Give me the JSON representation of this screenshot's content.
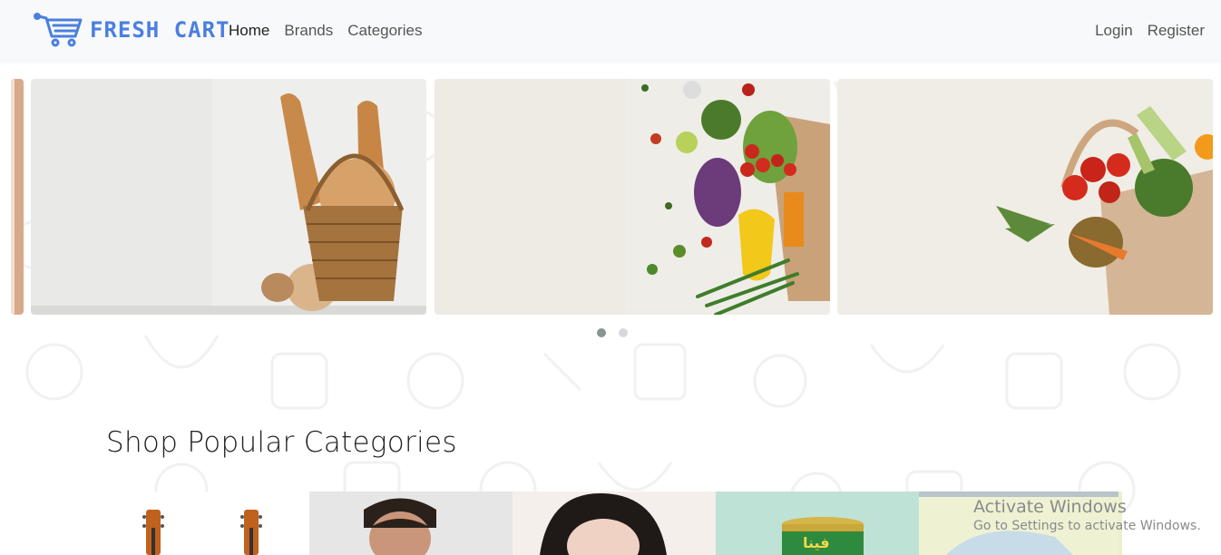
{
  "brand": {
    "name": "FRESH CART",
    "logo_icon": "shopping-cart-icon",
    "color": "#4a7fe0"
  },
  "nav": {
    "links": [
      {
        "label": "Home"
      },
      {
        "label": "Brands"
      },
      {
        "label": "Categories"
      }
    ],
    "auth": [
      {
        "label": "Login"
      },
      {
        "label": "Register"
      }
    ]
  },
  "slider": {
    "slides": [
      {
        "name": "slide-partial-left"
      },
      {
        "name": "slide-bread-basket"
      },
      {
        "name": "slide-vegetables-bag"
      },
      {
        "name": "slide-produce-tote"
      }
    ],
    "dots": 2,
    "active_dot": 1
  },
  "section": {
    "title": "Shop Popular Categories"
  },
  "categories": [
    {
      "name": "category-music"
    },
    {
      "name": "category-mens-fashion"
    },
    {
      "name": "category-womens-fashion"
    },
    {
      "name": "category-supermarket"
    },
    {
      "name": "category-baby-toys"
    }
  ],
  "watermark": {
    "title": "Activate Windows",
    "subtitle": "Go to Settings to activate Windows."
  }
}
